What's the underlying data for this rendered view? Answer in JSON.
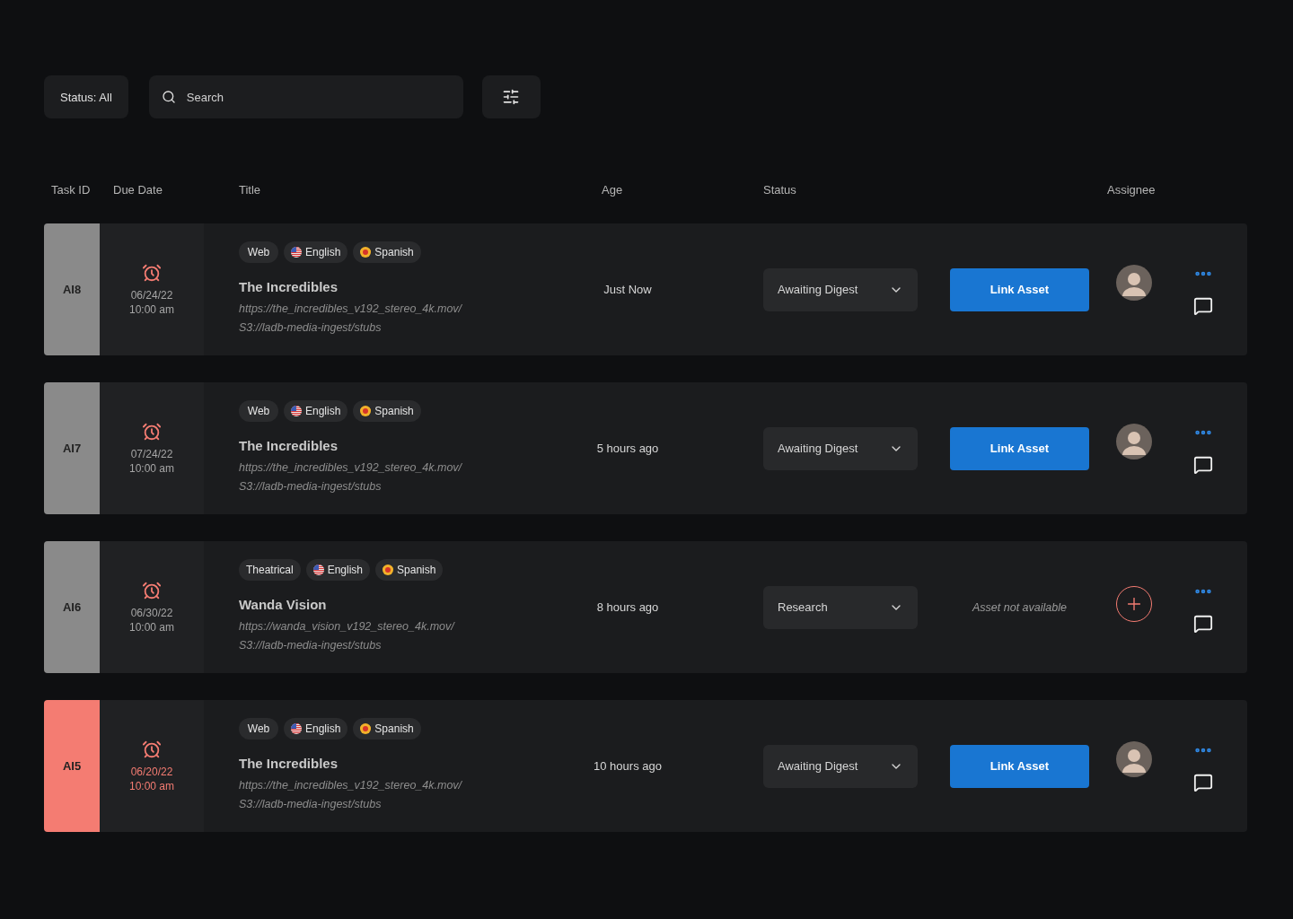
{
  "toolbar": {
    "status_filter": "Status: All",
    "search": {
      "placeholder": "Search"
    }
  },
  "columns": [
    "Task ID",
    "Due Date",
    "Title",
    "Age",
    "Status",
    "Assignee"
  ],
  "rows": [
    {
      "id": "AI8",
      "overdue": false,
      "date": "06/24/22",
      "time": "10:00 am",
      "tags": [
        {
          "label": "Web",
          "kind": "plain"
        },
        {
          "label": "English",
          "kind": "us"
        },
        {
          "label": "Spanish",
          "kind": "es"
        }
      ],
      "title": "The Incredibles",
      "url": "https://the_incredibles_v192_stereo_4k.mov/",
      "path": "S3://ladb-media-ingest/stubs",
      "age": "Just Now",
      "status": "Awaiting Digest",
      "asset": {
        "kind": "link",
        "label": "Link Asset"
      },
      "assigned": true
    },
    {
      "id": "AI7",
      "overdue": false,
      "date": "07/24/22",
      "time": "10:00 am",
      "tags": [
        {
          "label": "Web",
          "kind": "plain"
        },
        {
          "label": "English",
          "kind": "us"
        },
        {
          "label": "Spanish",
          "kind": "es"
        }
      ],
      "title": "The Incredibles",
      "url": "https://the_incredibles_v192_stereo_4k.mov/",
      "path": "S3://ladb-media-ingest/stubs",
      "age": "5 hours ago",
      "status": "Awaiting Digest",
      "asset": {
        "kind": "link",
        "label": "Link Asset"
      },
      "assigned": true
    },
    {
      "id": "AI6",
      "overdue": false,
      "date": "06/30/22",
      "time": "10:00 am",
      "tags": [
        {
          "label": "Theatrical",
          "kind": "plain"
        },
        {
          "label": "English",
          "kind": "us"
        },
        {
          "label": "Spanish",
          "kind": "es"
        }
      ],
      "title": "Wanda Vision",
      "url": "https://wanda_vision_v192_stereo_4k.mov/",
      "path": "S3://ladb-media-ingest/stubs",
      "age": "8 hours ago",
      "status": "Research",
      "asset": {
        "kind": "unavailable",
        "label": "Asset not available"
      },
      "assigned": false
    },
    {
      "id": "AI5",
      "overdue": true,
      "date": "06/20/22",
      "time": "10:00 am",
      "tags": [
        {
          "label": "Web",
          "kind": "plain"
        },
        {
          "label": "English",
          "kind": "us"
        },
        {
          "label": "Spanish",
          "kind": "es"
        }
      ],
      "title": "The Incredibles",
      "url": "https://the_incredibles_v192_stereo_4k.mov/",
      "path": "S3://ladb-media-ingest/stubs",
      "age": "10 hours ago",
      "status": "Awaiting Digest",
      "asset": {
        "kind": "link",
        "label": "Link Asset"
      },
      "assigned": true
    }
  ]
}
